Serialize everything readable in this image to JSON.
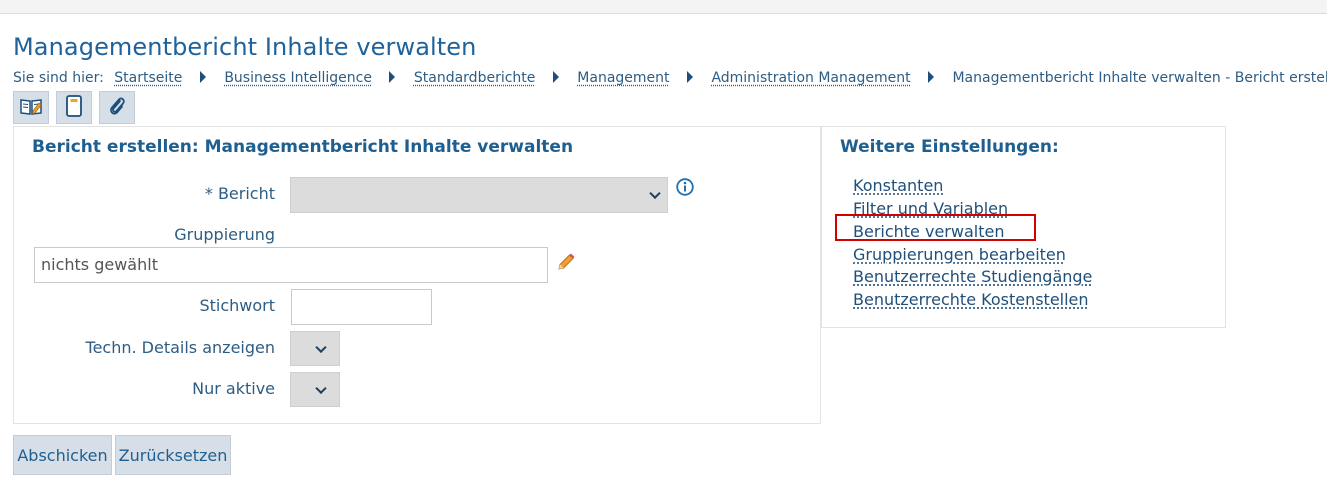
{
  "page": {
    "title": "Managementbericht Inhalte verwalten"
  },
  "breadcrumb": {
    "prefix": "Sie sind hier:",
    "items": [
      "Startseite",
      "Business Intelligence",
      "Standardberichte",
      "Management",
      "Administration Management",
      "Managementbericht Inhalte verwalten - Bericht erstellen"
    ]
  },
  "toolbar": {
    "icons": [
      "book-edit-icon",
      "notebook-icon",
      "paperclip-icon"
    ]
  },
  "form": {
    "heading": "Bericht erstellen: Managementbericht Inhalte verwalten",
    "bericht_label": "* Bericht",
    "bericht_value": "",
    "gruppierung_label": "Gruppierung",
    "gruppierung_value": "nichts gewählt",
    "stichwort_label": "Stichwort",
    "stichwort_value": "",
    "techn_label": "Techn. Details anzeigen",
    "techn_value": "",
    "aktiv_label": "Nur aktive",
    "aktiv_value": ""
  },
  "side": {
    "heading": "Weitere Einstellungen:",
    "links": [
      "Konstanten",
      "Filter und Variablen",
      "Berichte verwalten",
      "Gruppierungen bearbeiten",
      "Benutzerrechte Studiengänge",
      "Benutzerrechte Kostenstellen"
    ],
    "highlighted_link": "Berichte verwalten",
    "highlight_color": "#d40000"
  },
  "buttons": {
    "submit": "Abschicken",
    "reset": "Zurücksetzen"
  },
  "colors": {
    "accent": "#1f5f8f",
    "button_bg": "#d6dfe8",
    "select_bg": "#dcdcdc"
  }
}
